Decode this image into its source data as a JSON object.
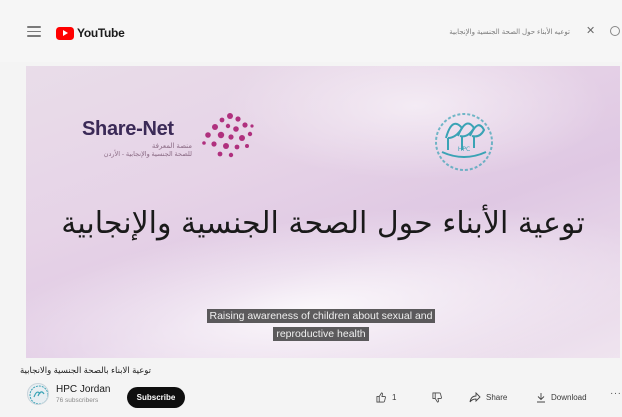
{
  "header": {
    "logo_text": "YouTube",
    "search_query": "توعيه الأبناء حول الصحة الجنسية والإنجابية",
    "search_clear": "✕"
  },
  "video": {
    "branding": {
      "sharenet_name": "Share-Net",
      "sharenet_line1": "منصة المعرفة",
      "sharenet_line2": "للصحة الجنسية والإنجابية - الأردن",
      "hpc_label": "HPC"
    },
    "slide_title": "توعية الأبناء حول الصحة الجنسية والإنجابية",
    "caption": "Raising awareness of children about sexual and reproductive health"
  },
  "info": {
    "title": "توعية الابناء بالصحة الجنسية والانجابية",
    "channel_name": "HPC Jordan",
    "subscribers": "76 subscribers",
    "subscribe_label": "Subscribe",
    "like_count": "1",
    "share_label": "Share",
    "download_label": "Download",
    "more_label": "···"
  }
}
